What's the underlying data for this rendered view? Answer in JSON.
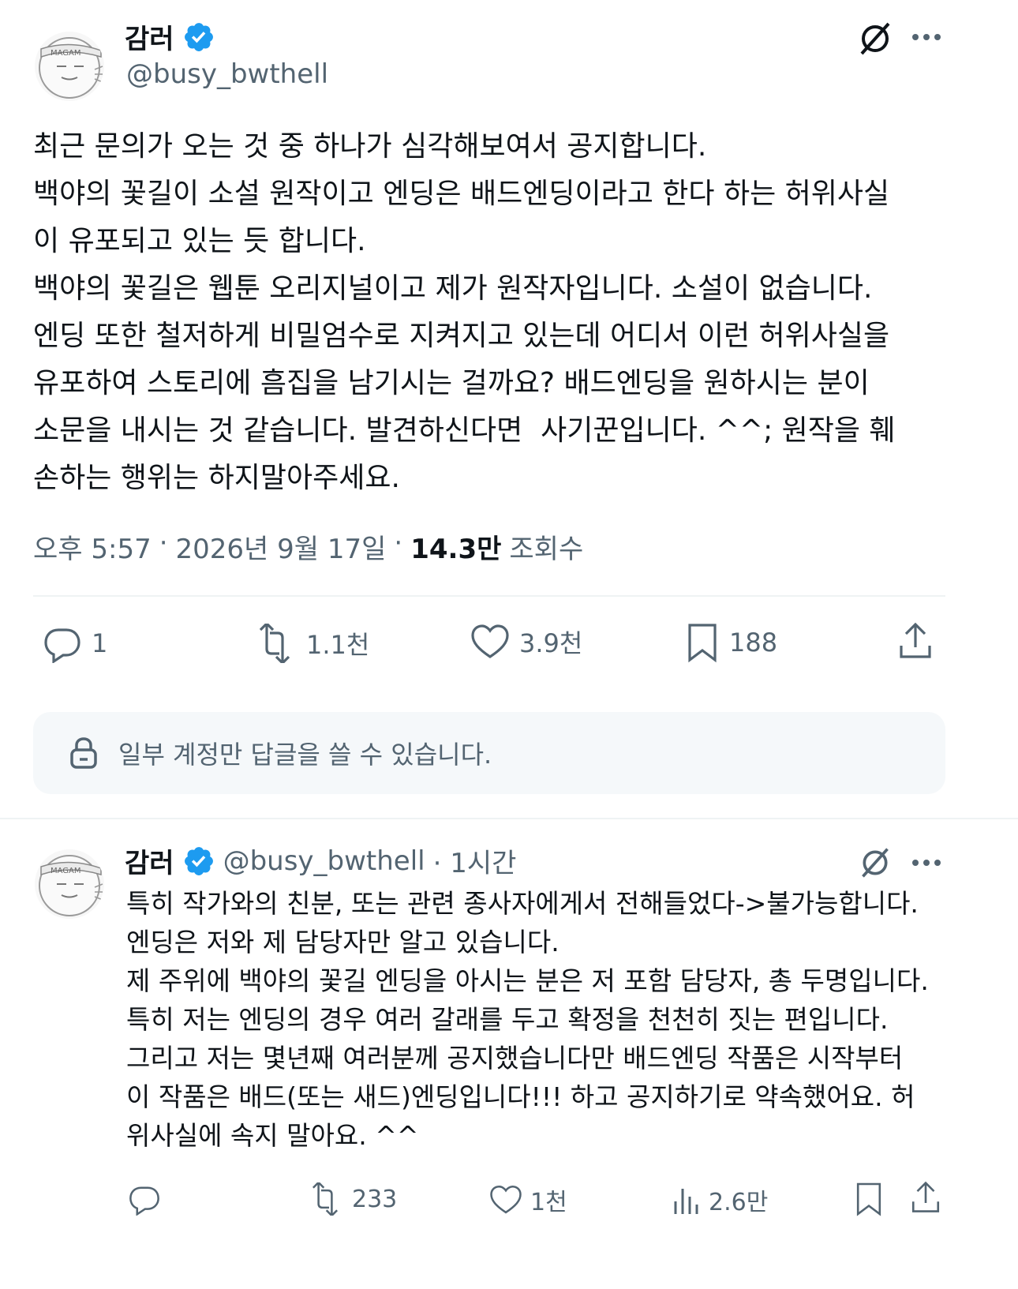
{
  "main_post": {
    "author": {
      "name": "감러",
      "handle": "@busy_bwthell",
      "verified": true,
      "avatar_text": "MAGAM"
    },
    "body": "최근 문의가 오는 것 중 하나가 심각해보여서 공지합니다.\n백야의 꽃길이 소설 원작이고 엔딩은 배드엔딩이라고 한다 하는 허위사실\n이 유포되고 있는 듯 합니다.\n백야의 꽃길은 웹툰 오리지널이고 제가 원작자입니다. 소설이 없습니다.\n엔딩 또한 철저하게 비밀엄수로 지켜지고 있는데 어디서 이런 허위사실을\n유포하여 스토리에 흠집을 남기시는 걸까요? 배드엔딩을 원하시는 분이\n소문을 내시는 것 같습니다. 발견하신다면  사기꾼입니다. ^^; 원작을 훼\n손하는 행위는 하지말아주세요.",
    "time": "오후 5:57",
    "date": "2026년 9월 17일",
    "views_count": "14.3만",
    "views_label": "조회수",
    "actions": {
      "replies": "1",
      "reposts": "1.1천",
      "likes": "3.9천",
      "bookmarks": "188"
    }
  },
  "reply_restriction": {
    "text": "일부 계정만 답글을 쓸 수 있습니다."
  },
  "reply_post": {
    "author": {
      "name": "감러",
      "handle": "@busy_bwthell",
      "verified": true,
      "avatar_text": "MAGAM"
    },
    "time_ago": "· 1시간",
    "body": "특히 작가와의 친분, 또는 관련 종사자에게서 전해들었다->불가능합니다.\n엔딩은 저와 제 담당자만 알고 있습니다.\n제 주위에 백야의 꽃길 엔딩을 아시는 분은 저 포함 담당자, 총 두명입니다.\n특히 저는 엔딩의 경우 여러 갈래를 두고 확정을 천천히 짓는 편입니다.\n그리고 저는 몇년째 여러분께 공지했습니다만 배드엔딩 작품은 시작부터\n이 작품은 배드(또는 새드)엔딩입니다!!! 하고 공지하기로 약속했어요. 허\n위사실에 속지 말아요. ^^",
    "actions": {
      "reposts": "233",
      "likes": "1천",
      "views": "2.6만"
    }
  },
  "colors": {
    "verified_blue": "#1d9bf0",
    "text_primary": "#0f1419",
    "text_secondary": "#536471"
  }
}
